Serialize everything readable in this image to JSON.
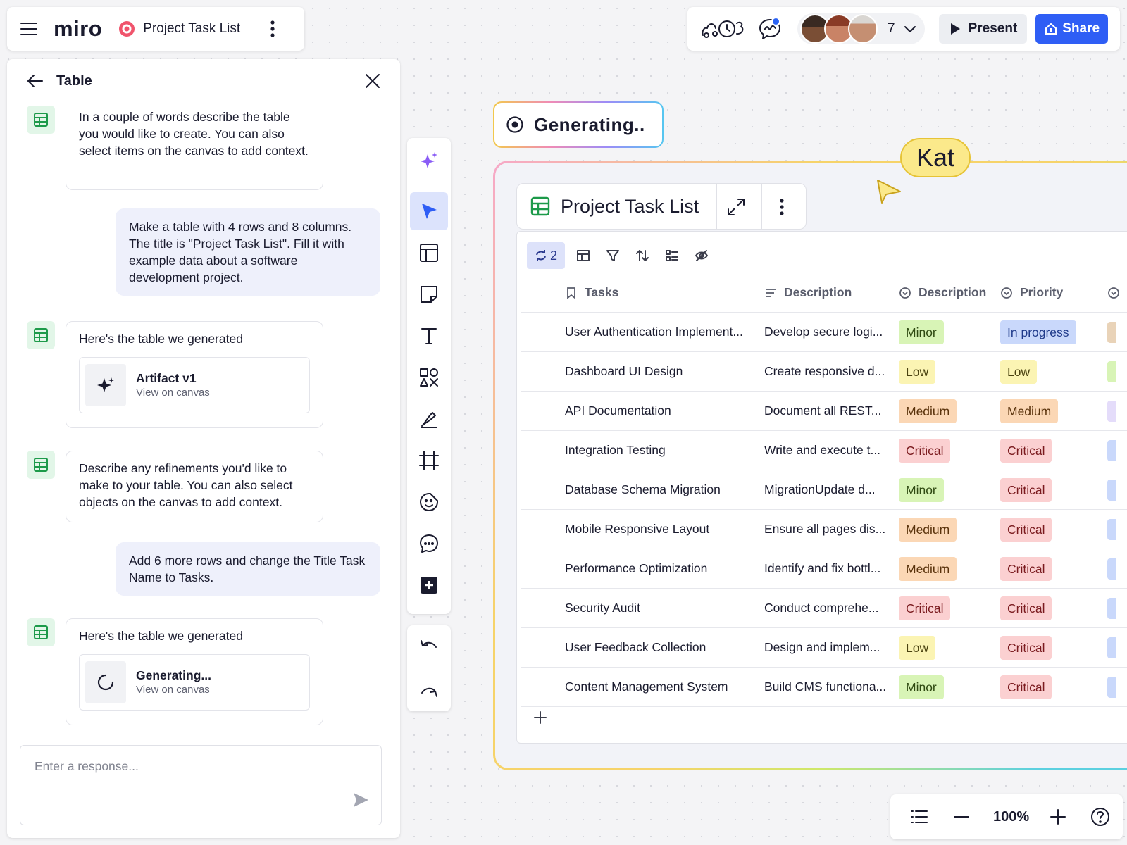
{
  "app": {
    "logo": "miro",
    "board_title": "Project Task List",
    "board_icon": "target-icon"
  },
  "topbar_right": {
    "collaborator_count": "7",
    "present_label": "Present",
    "share_label": "Share",
    "accent_color": "#2f5ef5"
  },
  "side_panel": {
    "title": "Table",
    "messages": [
      {
        "role": "bot",
        "text": "In a couple of words describe the table you would like to create. You can also select items on the canvas to add context."
      },
      {
        "role": "user",
        "text": "Make a table with 4 rows and 8 columns. The title is \"Project Task List\". Fill it with example data about a software development project."
      },
      {
        "role": "bot",
        "text": "Here's the table we generated",
        "artifact_name": "Artifact v1",
        "artifact_link": "View on canvas"
      },
      {
        "role": "bot",
        "text": "Describe any refinements you'd like to make to your table. You can also select objects on the canvas to add context."
      },
      {
        "role": "user",
        "text": "Add 6 more rows and change the Title Task Name to Tasks."
      },
      {
        "role": "bot",
        "text": "Here's the table we generated",
        "artifact_name": "Generating...",
        "artifact_link": "View on canvas"
      }
    ],
    "input_placeholder": "Enter a response..."
  },
  "toolbar": {
    "tools": [
      "ai-sparkle-icon",
      "select-cursor-icon",
      "templates-icon",
      "sticky-note-icon",
      "text-icon",
      "shapes-icon",
      "pen-icon",
      "frame-icon",
      "emoji-sticker-icon",
      "comment-icon",
      "more-tools-icon"
    ],
    "history": [
      "undo-icon",
      "redo-icon"
    ]
  },
  "canvas": {
    "generating_label": "Generating..",
    "cursor_user": "Kat",
    "table": {
      "title": "Project Task List",
      "version_count": "2",
      "columns": [
        "Tasks",
        "Description",
        "Description",
        "Priority"
      ],
      "rows": [
        {
          "task": "User Authentication Implement...",
          "description": "Develop secure logi...",
          "status": "Minor",
          "priority": "In progress"
        },
        {
          "task": "Dashboard UI Design",
          "description": "Create responsive d...",
          "status": "Low",
          "priority": "Low"
        },
        {
          "task": "API Documentation",
          "description": "Document all REST...",
          "status": "Medium",
          "priority": "Medium"
        },
        {
          "task": "Integration Testing",
          "description": "Write and execute t...",
          "status": "Critical",
          "priority": "Critical"
        },
        {
          "task": "Database Schema Migration",
          "description": " MigrationUpdate d...",
          "status": "Minor",
          "priority": "Critical"
        },
        {
          "task": "Mobile Responsive Layout",
          "description": "Ensure all pages dis...",
          "status": "Medium",
          "priority": "Critical"
        },
        {
          "task": "Performance Optimization",
          "description": "Identify and fix bottl...",
          "status": "Medium",
          "priority": "Critical"
        },
        {
          "task": "Security Audit",
          "description": "Conduct comprehe...",
          "status": "Critical",
          "priority": "Critical"
        },
        {
          "task": "User Feedback Collection",
          "description": "Design and implem...",
          "status": "Low",
          "priority": "Critical"
        },
        {
          "task": "Content Management System",
          "description": "Build CMS functiona...",
          "status": "Minor",
          "priority": "Critical"
        }
      ]
    }
  },
  "zoom": {
    "level": "100%"
  }
}
